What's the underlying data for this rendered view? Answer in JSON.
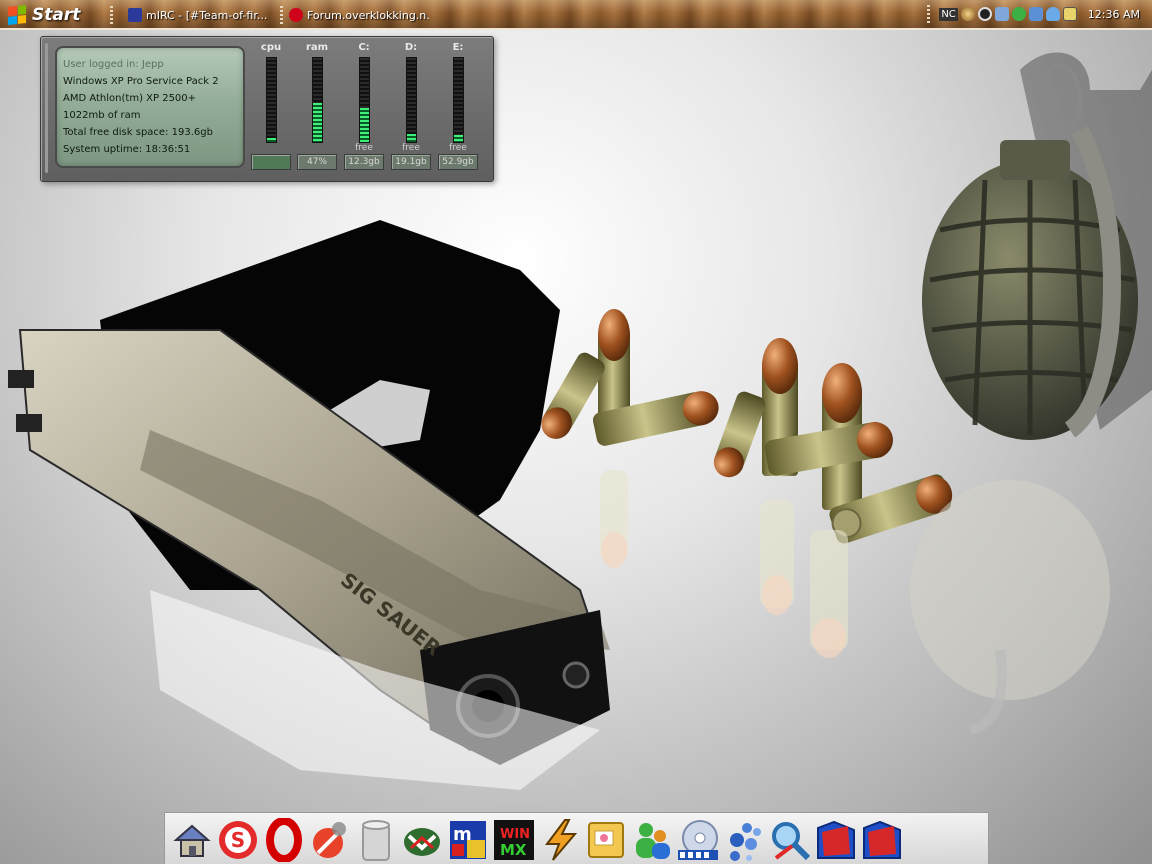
{
  "taskbar": {
    "start_label": "Start",
    "tasks": [
      {
        "label": "mIRC - [#Team-of-fir...",
        "icon": "mirc-icon",
        "color": "#2b3a9a"
      },
      {
        "label": "Forum.overklokking.n...",
        "icon": "opera-icon",
        "color": "#d0021b"
      }
    ],
    "tray_icons": [
      "nc-icon",
      "orb-icon",
      "steam-icon",
      "network-icon",
      "messenger-icon",
      "network-icon",
      "user-icon",
      "monitor-icon"
    ],
    "tray_nc_label": "NC",
    "clock": "12:36 AM"
  },
  "widget": {
    "info_lines": [
      "User logged in: Jepp",
      "Windows XP Pro Service Pack 2",
      "AMD Athlon(tm) XP 2500+",
      "1022mb of ram",
      "Total free disk space: 193.6gb",
      "System uptime: 18:36:51"
    ],
    "meters": [
      {
        "label": "cpu",
        "level": 0.05,
        "free": "",
        "value": ""
      },
      {
        "label": "ram",
        "level": 0.47,
        "free": "",
        "value": "47%"
      },
      {
        "label": "C:",
        "level": 0.4,
        "free": "free",
        "value": "12.3gb"
      },
      {
        "label": "D:",
        "level": 0.1,
        "free": "free",
        "value": "19.1gb"
      },
      {
        "label": "E:",
        "level": 0.08,
        "free": "free",
        "value": "52.9gb"
      }
    ]
  },
  "wallpaper": {
    "pistol_engraving": "SIG SAUER"
  },
  "dock": {
    "items": [
      "home-icon",
      "skype-icon",
      "opera-icon",
      "msn-search-icon",
      "trash-icon",
      "mail-icon",
      "mirc-icon",
      "winmx-icon",
      "winamp-icon",
      "outlook-icon",
      "messenger-icon",
      "media-player-icon",
      "bubbles-icon",
      "search-tool-icon",
      "folder-icon",
      "folder-icon"
    ]
  },
  "colors": {
    "meter_green": "#3df07a",
    "panel_green": "#94ad98",
    "wood": "#8b5a2b"
  }
}
